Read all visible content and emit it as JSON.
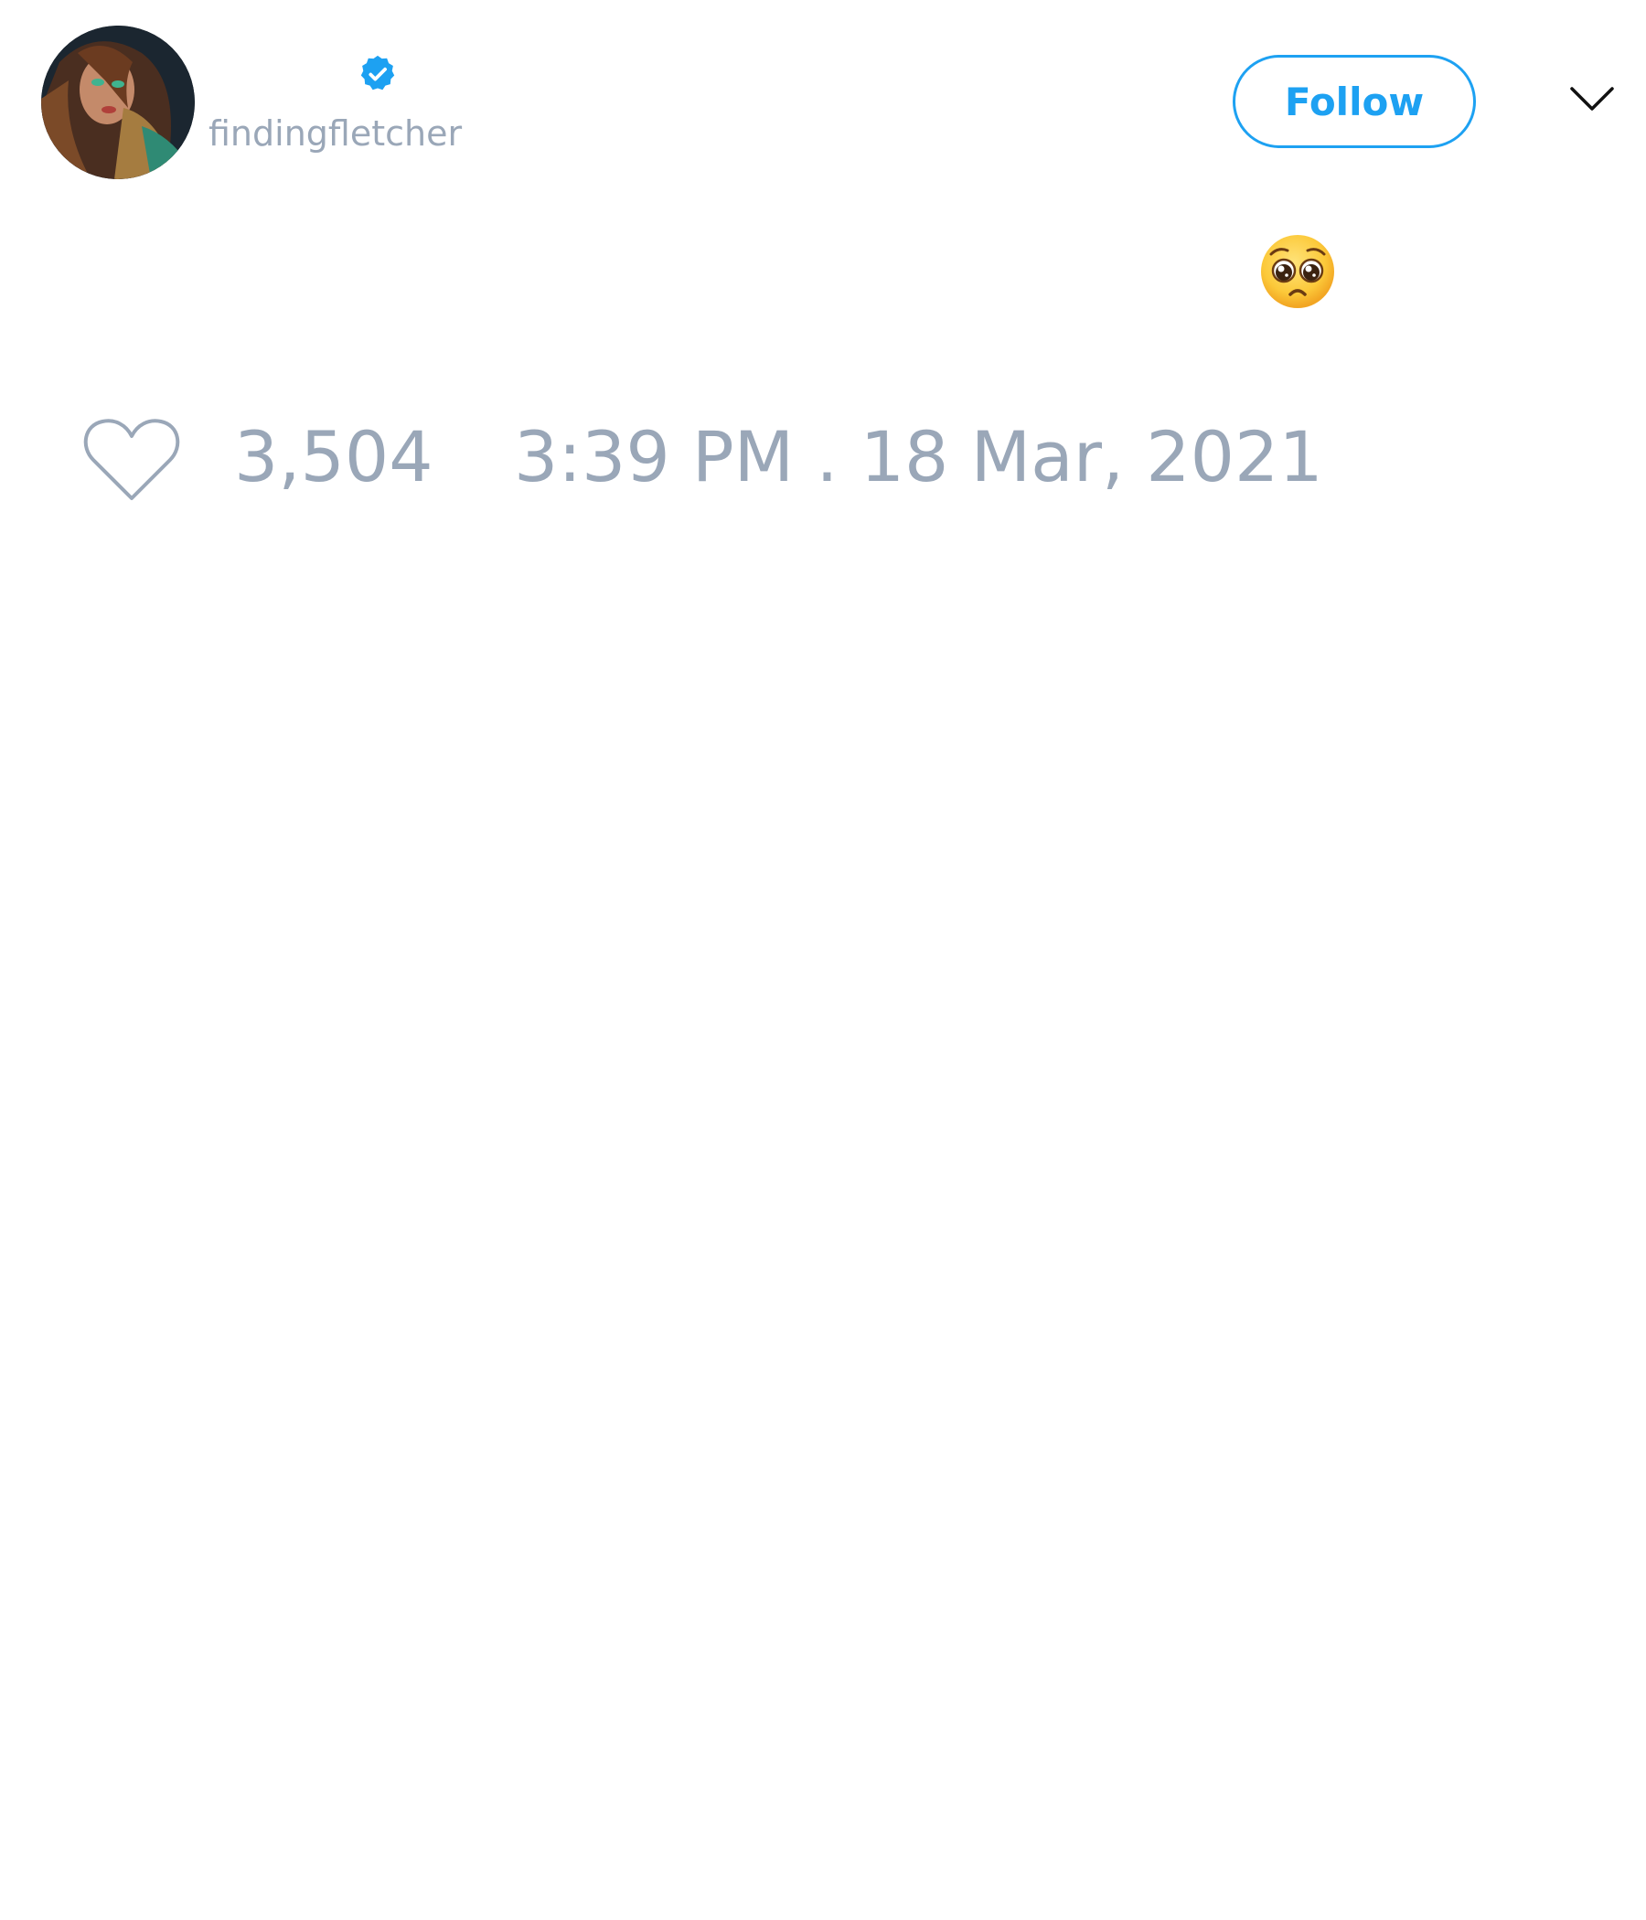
{
  "header": {
    "avatar_icon": "profile-photo",
    "verified_icon": "verified-badge-icon",
    "handle": "findingfletcher",
    "follow_label": "Follow",
    "menu_icon": "chevron-down-icon"
  },
  "tweet": {
    "emoji": "🥺"
  },
  "stats": {
    "like_icon": "heart-icon",
    "like_count": "3,504",
    "timestamp": "3:39 PM . 18 Mar, 2021"
  },
  "colors": {
    "accent": "#1da1f2",
    "muted_text": "#9aa7b8",
    "background": "#ffffff"
  }
}
